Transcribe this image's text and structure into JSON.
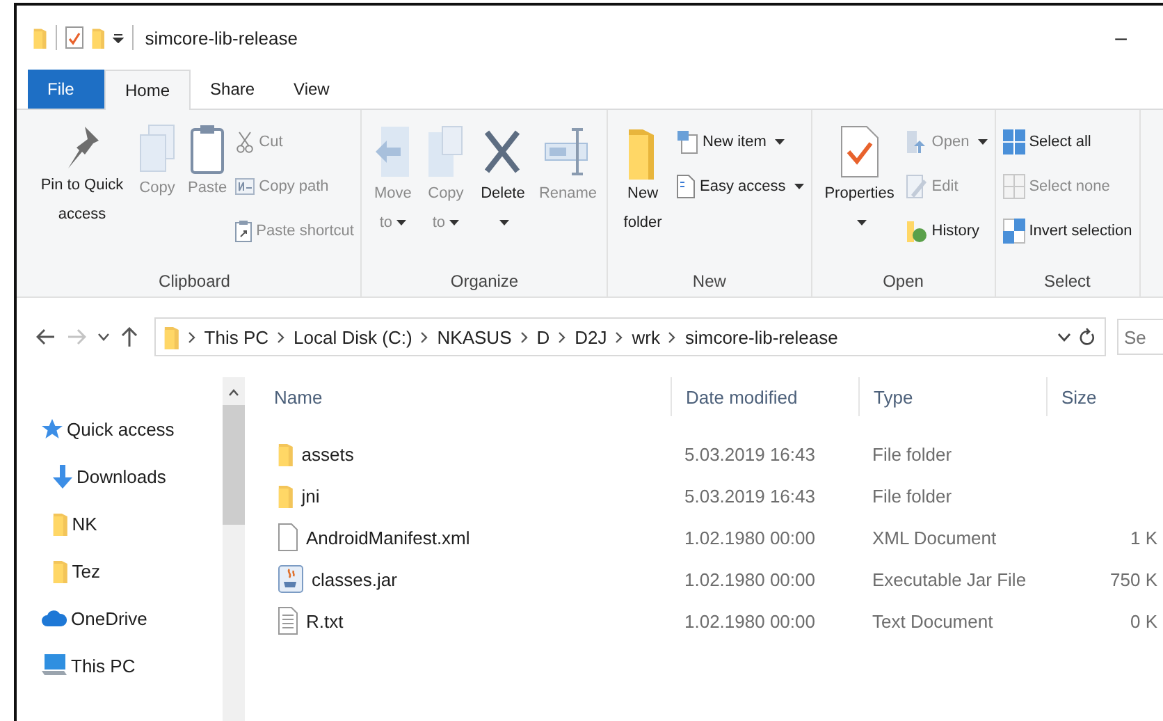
{
  "window": {
    "title": "simcore-lib-release",
    "minimize": "–"
  },
  "tabs": [
    {
      "label": "File",
      "kind": "file",
      "selected": false
    },
    {
      "label": "Home",
      "kind": "tab",
      "selected": true
    },
    {
      "label": "Share",
      "kind": "tab",
      "selected": false
    },
    {
      "label": "View",
      "kind": "tab",
      "selected": false
    }
  ],
  "ribbon": [
    {
      "label": "Clipboard",
      "large": [
        {
          "label": "Pin to Quick access",
          "disabled": false,
          "caret": false
        },
        {
          "label": "Copy",
          "disabled": true,
          "caret": false
        },
        {
          "label": "Paste",
          "disabled": true,
          "caret": false
        }
      ],
      "small": [
        {
          "label": "Cut",
          "disabled": true,
          "caret": false
        },
        {
          "label": "Copy path",
          "disabled": true,
          "caret": false
        },
        {
          "label": "Paste shortcut",
          "disabled": true,
          "caret": false
        }
      ]
    },
    {
      "label": "Organize",
      "large": [
        {
          "label": "Move to",
          "disabled": true,
          "caret": true
        },
        {
          "label": "Copy to",
          "disabled": true,
          "caret": true
        },
        {
          "label": "Delete",
          "disabled": false,
          "caret": true
        },
        {
          "label": "Rename",
          "disabled": true,
          "caret": false
        }
      ]
    },
    {
      "label": "New",
      "large": [
        {
          "label": "New folder",
          "disabled": false,
          "caret": false
        }
      ],
      "small": [
        {
          "label": "New item",
          "disabled": false,
          "caret": true
        },
        {
          "label": "Easy access",
          "disabled": false,
          "caret": true
        }
      ]
    },
    {
      "label": "Open",
      "large": [
        {
          "label": "Properties",
          "disabled": false,
          "caret": true
        }
      ],
      "small": [
        {
          "label": "Open",
          "disabled": true,
          "caret": true
        },
        {
          "label": "Edit",
          "disabled": true,
          "caret": false
        },
        {
          "label": "History",
          "disabled": false,
          "caret": false
        }
      ]
    },
    {
      "label": "Select",
      "small": [
        {
          "label": "Select all",
          "disabled": false,
          "caret": false
        },
        {
          "label": "Select none",
          "disabled": true,
          "caret": false
        },
        {
          "label": "Invert selection",
          "disabled": false,
          "caret": false
        }
      ]
    }
  ],
  "address": {
    "path": [
      "This PC",
      "Local Disk (C:)",
      "NKASUS",
      "D",
      "D2J",
      "wrk",
      "simcore-lib-release"
    ],
    "forward_disabled": true
  },
  "search": {
    "placeholder": "Se"
  },
  "sidebar": {
    "items": [
      {
        "label": "Quick access",
        "kind": "star",
        "children": [
          {
            "label": "Downloads",
            "kind": "download"
          },
          {
            "label": "NK",
            "kind": "folder"
          },
          {
            "label": "Tez",
            "kind": "folder"
          }
        ]
      },
      {
        "label": "OneDrive",
        "kind": "cloud"
      },
      {
        "label": "This PC",
        "kind": "pc"
      }
    ]
  },
  "table": {
    "columns": [
      "Name",
      "Date modified",
      "Type",
      "Size"
    ],
    "rows": [
      {
        "kind": "folder",
        "cells": [
          "assets",
          "5.03.2019 16:43",
          "File folder"
        ]
      },
      {
        "kind": "folder",
        "cells": [
          "jni",
          "5.03.2019 16:43",
          "File folder"
        ]
      },
      {
        "kind": "document",
        "cells": [
          "AndroidManifest.xml",
          "1.02.1980 00:00",
          "XML Document",
          "1 K"
        ]
      },
      {
        "kind": "jar",
        "cells": [
          "classes.jar",
          "1.02.1980 00:00",
          "Executable Jar File",
          "750 K"
        ]
      },
      {
        "kind": "text",
        "cells": [
          "R.txt",
          "1.02.1980 00:00",
          "Text Document",
          "0 K"
        ]
      }
    ]
  }
}
